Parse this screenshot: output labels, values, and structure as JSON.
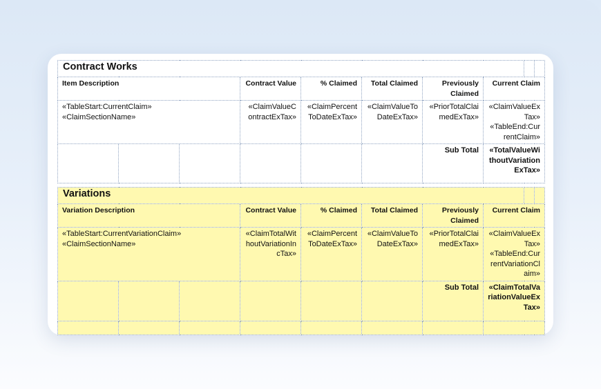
{
  "contract": {
    "title": "Contract Works",
    "headers": {
      "description": "Item Description",
      "contract_value": "Contract Value",
      "pct_claimed": "% Claimed",
      "total_claimed": "Total Claimed",
      "previously_claimed": "Previously Claimed",
      "current_claim": "Current Claim"
    },
    "row": {
      "description_1": "«TableStart:CurrentClaim»",
      "description_2": "«ClaimSectionName»",
      "contract_value": "«ClaimValueContractExTax»",
      "pct_claimed": "«ClaimPercentToDateExTax»",
      "total_claimed": "«ClaimValueToDateExTax»",
      "previously_claimed": "«PriorTotalClaimedExTax»",
      "current_claim_1": "«ClaimValueExTax»",
      "current_claim_2": "«TableEnd:CurrentClaim»"
    },
    "subtotal_label": "Sub Total",
    "subtotal_value": "«TotalValueWithoutVariationExTax»"
  },
  "variations": {
    "title": "Variations",
    "headers": {
      "description": "Variation Description",
      "contract_value": "Contract Value",
      "pct_claimed": "% Claimed",
      "total_claimed": "Total Claimed",
      "previously_claimed": "Previously Claimed",
      "current_claim": "Current Claim"
    },
    "row": {
      "description_1": "«TableStart:CurrentVariationClaim»",
      "description_2": "«ClaimSectionName»",
      "contract_value": "«ClaimTotalWithoutVariationIncTax»",
      "pct_claimed": "«ClaimPercentToDateExTax»",
      "total_claimed": "«ClaimValueToDateExTax»",
      "previously_claimed": "«PriorTotalClaimedExTax»",
      "current_claim_1": "«ClaimValueExTax»",
      "current_claim_2": "«TableEnd:CurrentVariationClaim»"
    },
    "subtotal_label": "Sub Total",
    "subtotal_value": "«ClaimTotalVariationValueExTax»"
  }
}
